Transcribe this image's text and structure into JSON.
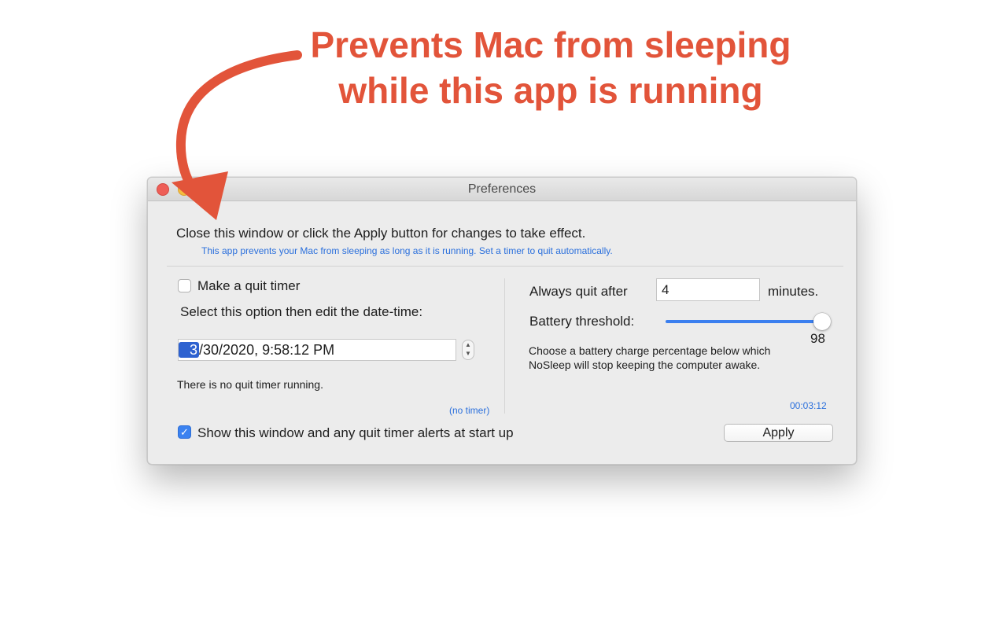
{
  "promo": {
    "line1": "Prevents Mac from sleeping",
    "line2": "while this app is running",
    "accent_color": "#e2543a"
  },
  "window": {
    "title": "Preferences",
    "controls": [
      "close",
      "minimize"
    ]
  },
  "header": {
    "instruction": "Close this window or click the Apply button for changes to take effect.",
    "description": "This app prevents your Mac from sleeping as long as it is running. Set a timer to quit automatically."
  },
  "left": {
    "quit_timer_checkbox": {
      "label": "Make a quit timer",
      "checked": false
    },
    "select_option_label": "Select this option then edit the date-time:",
    "datetime": {
      "month_selected": "3",
      "rest": "/30/2020,   9:58:12 PM"
    },
    "status": "There is no quit timer running.",
    "timer_link": "(no timer)"
  },
  "right": {
    "always_quit_label": "Always quit after",
    "minutes_value": "4",
    "minutes_unit": "minutes.",
    "battery_label": "Battery threshold:",
    "battery_value": "98",
    "battery_fraction": 0.98,
    "battery_note_line1": "Choose a battery charge percentage below which",
    "battery_note_line2": "NoSleep will stop keeping the computer awake.",
    "elapsed": "00:03:12"
  },
  "footer": {
    "show_window_checkbox": {
      "label": "Show this window and any quit timer alerts at start up",
      "checked": true
    },
    "apply_label": "Apply"
  },
  "colors": {
    "accent_blue": "#3b7fef",
    "link_blue": "#2a6fdc",
    "window_bg": "#ececec"
  }
}
